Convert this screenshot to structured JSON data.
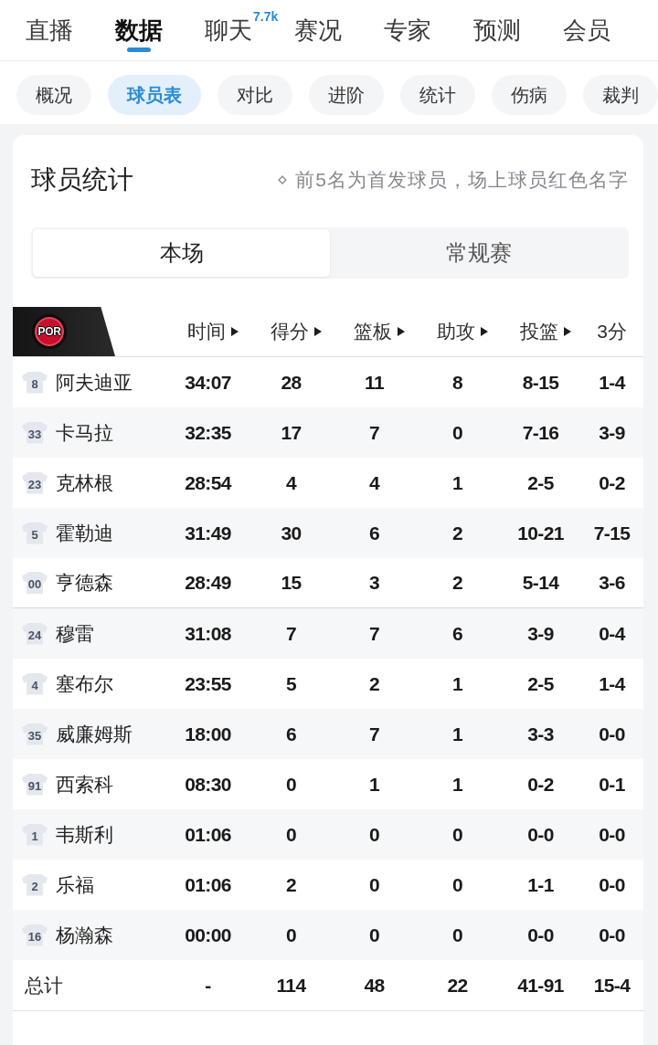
{
  "top_tabs": [
    {
      "label": "直播",
      "selected": false
    },
    {
      "label": "数据",
      "selected": true
    },
    {
      "label": "聊天",
      "selected": false,
      "badge": "7.7k"
    },
    {
      "label": "赛况",
      "selected": false
    },
    {
      "label": "专家",
      "selected": false
    },
    {
      "label": "预测",
      "selected": false
    },
    {
      "label": "会员",
      "selected": false
    }
  ],
  "sub_tabs": [
    {
      "label": "概况",
      "selected": false
    },
    {
      "label": "球员表",
      "selected": true
    },
    {
      "label": "对比",
      "selected": false
    },
    {
      "label": "进阶",
      "selected": false
    },
    {
      "label": "统计",
      "selected": false
    },
    {
      "label": "伤病",
      "selected": false
    },
    {
      "label": "裁判",
      "selected": false
    }
  ],
  "player_stats": {
    "title": "球员统计",
    "hint": "前5名为首发球员，场上球员红色名字",
    "scope_tabs": [
      {
        "label": "本场",
        "selected": true
      },
      {
        "label": "常规赛",
        "selected": false
      }
    ],
    "table": {
      "team": "POR",
      "columns": [
        {
          "label": "时间",
          "sort_arrow": true
        },
        {
          "label": "得分",
          "sort_arrow": true
        },
        {
          "label": "篮板",
          "sort_arrow": true
        },
        {
          "label": "助攻",
          "sort_arrow": true
        },
        {
          "label": "投篮",
          "sort_arrow": true
        },
        {
          "label": "3分",
          "sort_arrow": false
        }
      ],
      "starters": [
        {
          "number": "8",
          "name": "阿夫迪亚",
          "cells": [
            "34:07",
            "28",
            "11",
            "8",
            "8-15",
            "1-4"
          ]
        },
        {
          "number": "33",
          "name": "卡马拉",
          "cells": [
            "32:35",
            "17",
            "7",
            "0",
            "7-16",
            "3-9"
          ]
        },
        {
          "number": "23",
          "name": "克林根",
          "cells": [
            "28:54",
            "4",
            "4",
            "1",
            "2-5",
            "0-2"
          ]
        },
        {
          "number": "5",
          "name": "霍勒迪",
          "cells": [
            "31:49",
            "30",
            "6",
            "2",
            "10-21",
            "7-15"
          ]
        },
        {
          "number": "00",
          "name": "亨德森",
          "cells": [
            "28:49",
            "15",
            "3",
            "2",
            "5-14",
            "3-6"
          ]
        }
      ],
      "bench": [
        {
          "number": "24",
          "name": "穆雷",
          "cells": [
            "31:08",
            "7",
            "7",
            "6",
            "3-9",
            "0-4"
          ]
        },
        {
          "number": "4",
          "name": "塞布尔",
          "cells": [
            "23:55",
            "5",
            "2",
            "1",
            "2-5",
            "1-4"
          ]
        },
        {
          "number": "35",
          "name": "威廉姆斯",
          "cells": [
            "18:00",
            "6",
            "7",
            "1",
            "3-3",
            "0-0"
          ]
        },
        {
          "number": "91",
          "name": "西索科",
          "cells": [
            "08:30",
            "0",
            "1",
            "1",
            "0-2",
            "0-1"
          ]
        },
        {
          "number": "1",
          "name": "韦斯利",
          "cells": [
            "01:06",
            "0",
            "0",
            "0",
            "0-0",
            "0-0"
          ]
        },
        {
          "number": "2",
          "name": "乐福",
          "cells": [
            "01:06",
            "2",
            "0",
            "0",
            "1-1",
            "0-0"
          ]
        },
        {
          "number": "16",
          "name": "杨瀚森",
          "cells": [
            "00:00",
            "0",
            "0",
            "0",
            "0-0",
            "0-0"
          ]
        }
      ],
      "total": {
        "label": "总计",
        "cells": [
          "-",
          "114",
          "48",
          "22",
          "41-91",
          "15-4"
        ]
      }
    }
  }
}
